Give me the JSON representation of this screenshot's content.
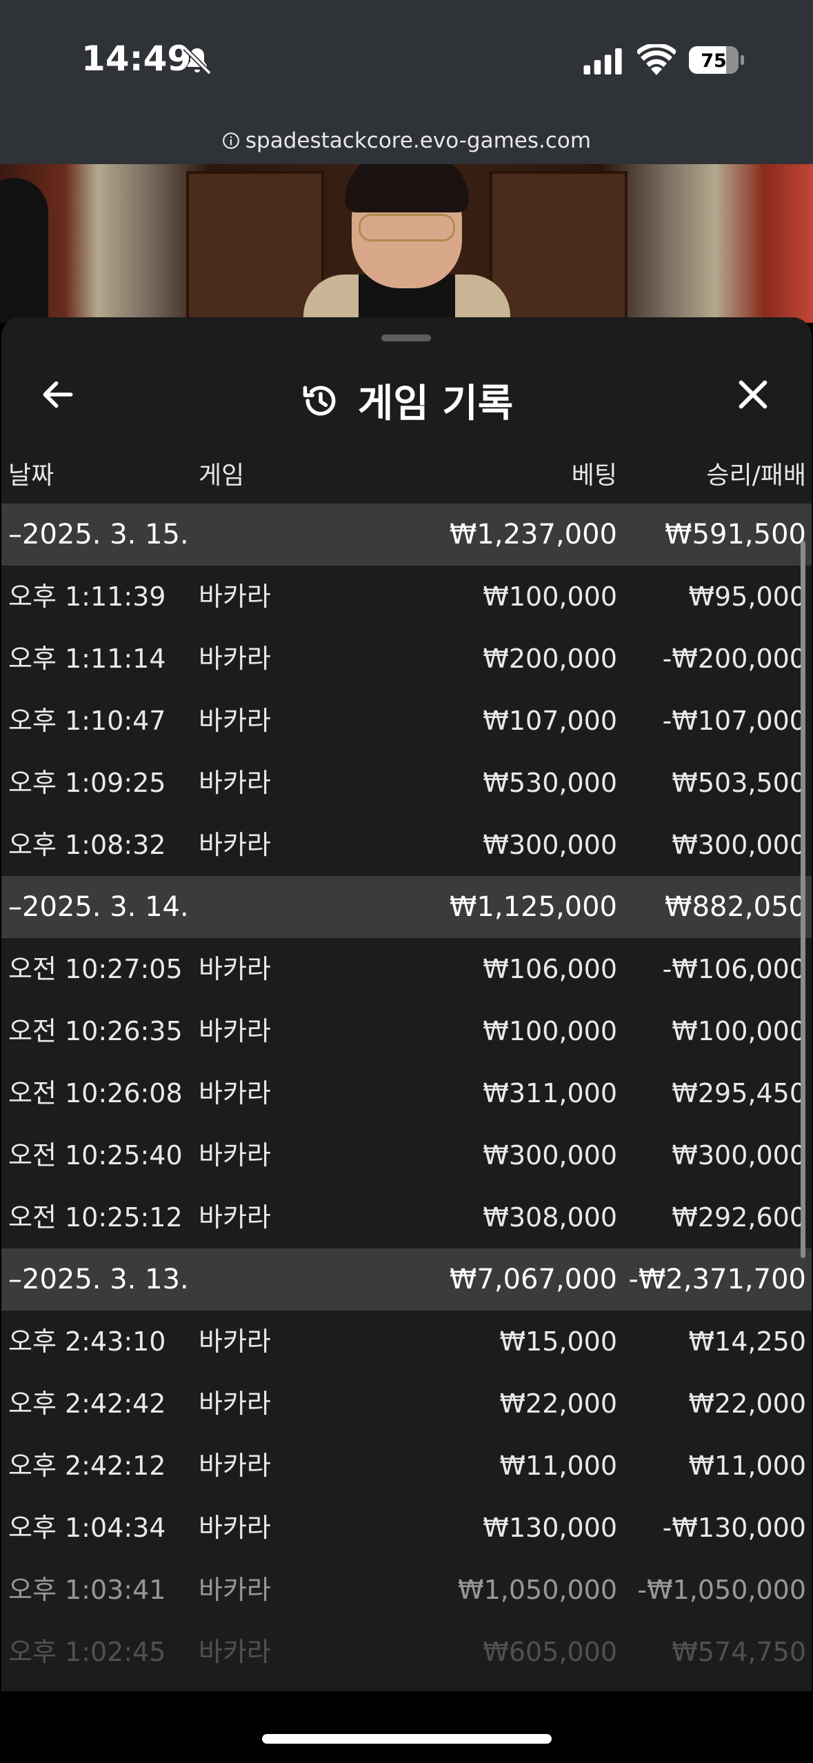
{
  "status": {
    "time": "14:49",
    "battery": "75"
  },
  "browser": {
    "url": "spadestackcore.evo-games.com"
  },
  "sheet": {
    "title": "게임 기록",
    "columns": {
      "date": "날짜",
      "game": "게임",
      "bet": "베팅",
      "win_loss": "승리/패배"
    },
    "groups": [
      {
        "date": "–2025. 3. 15.",
        "bet_total": "₩1,237,000",
        "win_total": "₩591,500",
        "rows": [
          {
            "time": "오후 1:11:39",
            "game": "바카라",
            "bet": "₩100,000",
            "win": "₩95,000"
          },
          {
            "time": "오후 1:11:14",
            "game": "바카라",
            "bet": "₩200,000",
            "win": "-₩200,000"
          },
          {
            "time": "오후 1:10:47",
            "game": "바카라",
            "bet": "₩107,000",
            "win": "-₩107,000"
          },
          {
            "time": "오후 1:09:25",
            "game": "바카라",
            "bet": "₩530,000",
            "win": "₩503,500"
          },
          {
            "time": "오후 1:08:32",
            "game": "바카라",
            "bet": "₩300,000",
            "win": "₩300,000"
          }
        ]
      },
      {
        "date": "–2025. 3. 14.",
        "bet_total": "₩1,125,000",
        "win_total": "₩882,050",
        "rows": [
          {
            "time": "오전 10:27:05",
            "game": "바카라",
            "bet": "₩106,000",
            "win": "-₩106,000"
          },
          {
            "time": "오전 10:26:35",
            "game": "바카라",
            "bet": "₩100,000",
            "win": "₩100,000"
          },
          {
            "time": "오전 10:26:08",
            "game": "바카라",
            "bet": "₩311,000",
            "win": "₩295,450"
          },
          {
            "time": "오전 10:25:40",
            "game": "바카라",
            "bet": "₩300,000",
            "win": "₩300,000"
          },
          {
            "time": "오전 10:25:12",
            "game": "바카라",
            "bet": "₩308,000",
            "win": "₩292,600"
          }
        ]
      },
      {
        "date": "–2025. 3. 13.",
        "bet_total": "₩7,067,000",
        "win_total": "-₩2,371,700",
        "rows": [
          {
            "time": "오후 2:43:10",
            "game": "바카라",
            "bet": "₩15,000",
            "win": "₩14,250"
          },
          {
            "time": "오후 2:42:42",
            "game": "바카라",
            "bet": "₩22,000",
            "win": "₩22,000"
          },
          {
            "time": "오후 2:42:12",
            "game": "바카라",
            "bet": "₩11,000",
            "win": "₩11,000"
          },
          {
            "time": "오후 1:04:34",
            "game": "바카라",
            "bet": "₩130,000",
            "win": "-₩130,000"
          },
          {
            "time": "오후 1:03:41",
            "game": "바카라",
            "bet": "₩1,050,000",
            "win": "-₩1,050,000"
          },
          {
            "time": "오후 1:02:45",
            "game": "바카라",
            "bet": "₩605,000",
            "win": "₩574,750"
          }
        ]
      }
    ]
  }
}
